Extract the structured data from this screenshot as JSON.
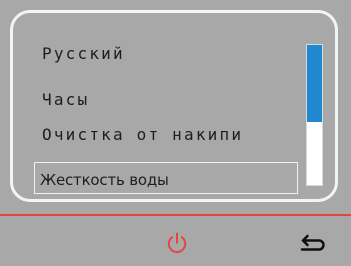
{
  "menu": {
    "items": [
      {
        "label": "Русский"
      },
      {
        "label": "Часы"
      },
      {
        "label": "Очистка от накипи"
      },
      {
        "label": "Жесткость воды",
        "selected": true
      }
    ],
    "scroll_position": 0.55
  },
  "footer": {
    "power_icon": "power-icon",
    "back_icon": "back-arrow-icon"
  },
  "colors": {
    "background": "#a8a8a8",
    "frame": "#f4f4f4",
    "accent_red": "#e5473e",
    "scroll_thumb": "#1f89cf"
  }
}
